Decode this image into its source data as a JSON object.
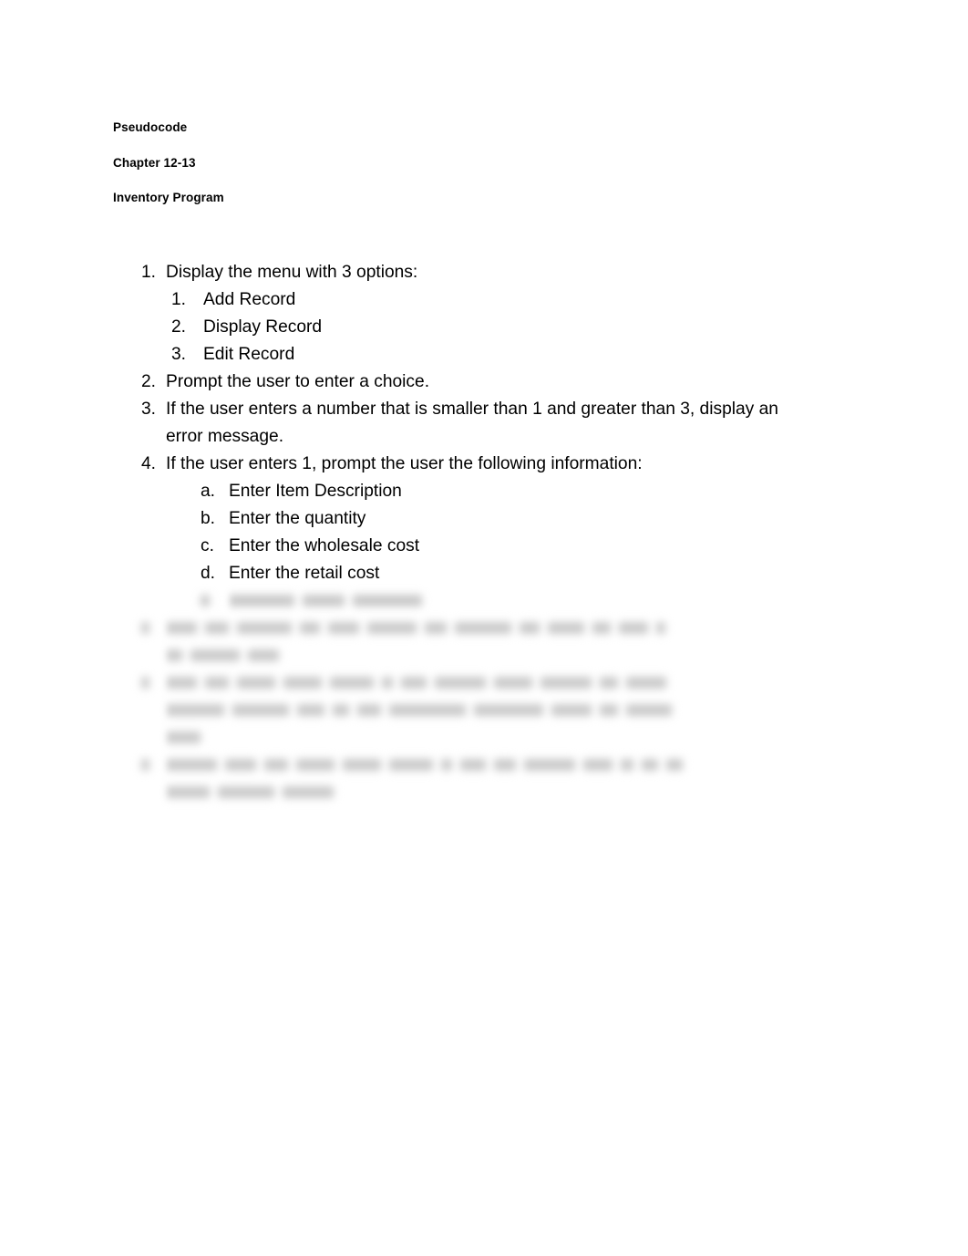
{
  "document": {
    "headings": [
      "Pseudocode",
      "Chapter 12-13",
      "Inventory Program"
    ],
    "list": {
      "item1": {
        "marker": "1.",
        "text": "Display the menu with 3 options:",
        "subitems": [
          {
            "marker": "1.",
            "text": "Add Record"
          },
          {
            "marker": "2.",
            "text": "Display Record"
          },
          {
            "marker": "3.",
            "text": "Edit Record"
          }
        ]
      },
      "item2": {
        "marker": "2.",
        "text": "Prompt the user to enter a choice."
      },
      "item3": {
        "marker": "3.",
        "text": "If the user enters a number that is smaller than 1 and greater than 3, display an error message."
      },
      "item4": {
        "marker": "4.",
        "text": "If the user enters 1, prompt the user the following information:",
        "subitems": [
          {
            "marker": "a.",
            "text": "Enter Item Description"
          },
          {
            "marker": "b.",
            "text": "Enter the quantity"
          },
          {
            "marker": "c.",
            "text": "Enter the wholesale cost"
          },
          {
            "marker": "d.",
            "text": "Enter the retail cost"
          }
        ],
        "illegible_subitem": {
          "marker": "",
          "text": "",
          "note": "blurred-illegible",
          "word_widths": [
            72,
            46,
            76
          ]
        }
      },
      "illegible_items": [
        {
          "marker": "",
          "note": "blurred-illegible",
          "lines": [
            [
              34,
              26,
              60,
              22,
              34,
              54,
              24,
              62,
              22,
              40,
              20,
              32,
              10
            ],
            [
              18,
              54,
              34
            ]
          ]
        },
        {
          "marker": "",
          "note": "blurred-illegible",
          "lines": [
            [
              34,
              26,
              42,
              42,
              48,
              12,
              28,
              56,
              42,
              56,
              20,
              44
            ],
            [
              64,
              62,
              30,
              18,
              26,
              84,
              76,
              44,
              20,
              50
            ],
            [
              38
            ]
          ]
        },
        {
          "marker": "",
          "note": "blurred-illegible",
          "lines": [
            [
              56,
              34,
              26,
              42,
              42,
              48,
              12,
              28,
              24,
              56,
              32,
              14,
              18,
              18
            ],
            [
              48,
              62,
              56
            ]
          ]
        }
      ]
    }
  }
}
